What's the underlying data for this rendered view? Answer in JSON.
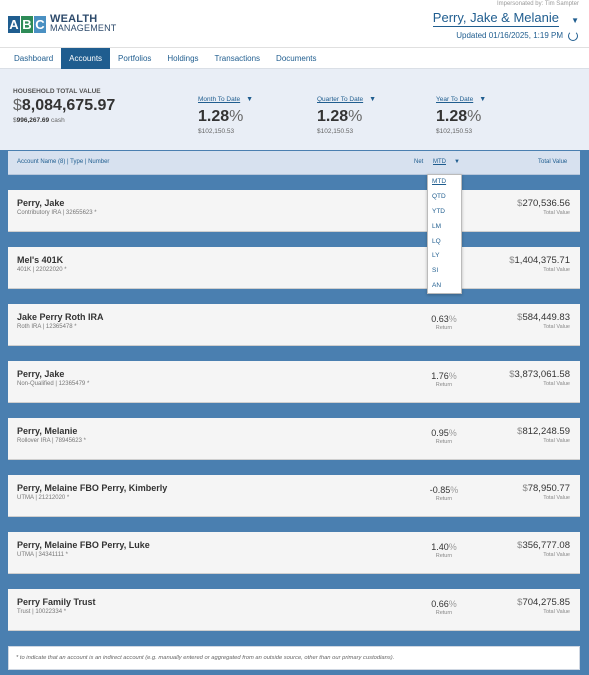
{
  "header": {
    "logo_letters": [
      "A",
      "B",
      "C"
    ],
    "logo_colors": [
      "#1f5d8f",
      "#2e8b57",
      "#4a90c2"
    ],
    "logo_line1": "WEALTH",
    "logo_line2": "MANAGEMENT",
    "impersonated": "Impersonated by: Tim Sampter",
    "client_name": "Perry, Jake & Melanie",
    "updated": "Updated 01/16/2025, 1:19 PM"
  },
  "nav": {
    "tabs": [
      {
        "label": "Dashboard",
        "active": false
      },
      {
        "label": "Accounts",
        "active": true
      },
      {
        "label": "Portfolios",
        "active": false
      },
      {
        "label": "Holdings",
        "active": false
      },
      {
        "label": "Transactions",
        "active": false
      },
      {
        "label": "Documents",
        "active": false
      }
    ]
  },
  "summary": {
    "total_label": "HOUSEHOLD TOTAL VALUE",
    "total_currency": "$",
    "total_value": "8,084,675.97",
    "cash_currency": "$",
    "cash_value": "996,267.69",
    "cash_label": "cash",
    "periods": [
      {
        "label": "Month To Date",
        "pct": "1.28",
        "pct_unit": "%",
        "amount": "$102,150.53"
      },
      {
        "label": "Quarter To Date",
        "pct": "1.28",
        "pct_unit": "%",
        "amount": "$102,150.53"
      },
      {
        "label": "Year To Date",
        "pct": "1.28",
        "pct_unit": "%",
        "amount": "$102,150.53"
      }
    ]
  },
  "columns": {
    "account_name": "Account Name (8)",
    "separator": "|",
    "type": "Type",
    "number": "Number",
    "net": "Net",
    "period": "MTD",
    "total_value": "Total Value"
  },
  "dropdown": {
    "options": [
      "MTD",
      "QTD",
      "YTD",
      "LM",
      "LQ",
      "LY",
      "SI",
      "AN"
    ],
    "selected": "MTD"
  },
  "accounts": [
    {
      "name": "Perry, Jake",
      "sub": "Contributory IRA | 32655623 *",
      "ret": "",
      "ret_unit": "",
      "ret_label": "",
      "amt_cur": "$",
      "amt": "270,536.56",
      "amt_label": "Total Value"
    },
    {
      "name": "Mel's 401K",
      "sub": "401K | 22022020 *",
      "ret": "",
      "ret_unit": "",
      "ret_label": "",
      "amt_cur": "$",
      "amt": "1,404,375.71",
      "amt_label": "Total Value"
    },
    {
      "name": "Jake Perry Roth IRA",
      "sub": "Roth IRA | 12365478 *",
      "ret": "0.63",
      "ret_unit": "%",
      "ret_label": "Return",
      "amt_cur": "$",
      "amt": "584,449.83",
      "amt_label": "Total Value"
    },
    {
      "name": "Perry, Jake",
      "sub": "Non-Qualified | 12365479 *",
      "ret": "1.76",
      "ret_unit": "%",
      "ret_label": "Return",
      "amt_cur": "$",
      "amt": "3,873,061.58",
      "amt_label": "Total Value"
    },
    {
      "name": "Perry, Melanie",
      "sub": "Rollover IRA | 78945623 *",
      "ret": "0.95",
      "ret_unit": "%",
      "ret_label": "Return",
      "amt_cur": "$",
      "amt": "812,248.59",
      "amt_label": "Total Value"
    },
    {
      "name": "Perry, Melaine FBO Perry, Kimberly",
      "sub": "UTMA | 21212020 *",
      "ret": "-0.85",
      "ret_unit": "%",
      "ret_label": "Return",
      "amt_cur": "$",
      "amt": "78,950.77",
      "amt_label": "Total Value"
    },
    {
      "name": "Perry, Melaine FBO Perry, Luke",
      "sub": "UTMA | 34341111 *",
      "ret": "1.40",
      "ret_unit": "%",
      "ret_label": "Return",
      "amt_cur": "$",
      "amt": "356,777.08",
      "amt_label": "Total Value"
    },
    {
      "name": "Perry Family Trust",
      "sub": "Trust | 10022334 *",
      "ret": "0.66",
      "ret_unit": "%",
      "ret_label": "Return",
      "amt_cur": "$",
      "amt": "704,275.85",
      "amt_label": "Total Value"
    }
  ],
  "footnote": "* to indicate that an account is an indirect account (e.g. manually entered or aggregated from an outside source, other than our primary custodians)."
}
